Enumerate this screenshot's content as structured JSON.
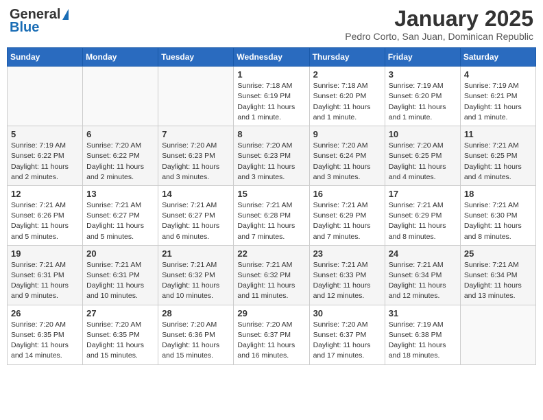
{
  "logo": {
    "general": "General",
    "blue": "Blue"
  },
  "title": "January 2025",
  "location": "Pedro Corto, San Juan, Dominican Republic",
  "days_of_week": [
    "Sunday",
    "Monday",
    "Tuesday",
    "Wednesday",
    "Thursday",
    "Friday",
    "Saturday"
  ],
  "weeks": [
    [
      {
        "day": "",
        "info": ""
      },
      {
        "day": "",
        "info": ""
      },
      {
        "day": "",
        "info": ""
      },
      {
        "day": "1",
        "info": "Sunrise: 7:18 AM\nSunset: 6:19 PM\nDaylight: 11 hours\nand 1 minute."
      },
      {
        "day": "2",
        "info": "Sunrise: 7:18 AM\nSunset: 6:20 PM\nDaylight: 11 hours\nand 1 minute."
      },
      {
        "day": "3",
        "info": "Sunrise: 7:19 AM\nSunset: 6:20 PM\nDaylight: 11 hours\nand 1 minute."
      },
      {
        "day": "4",
        "info": "Sunrise: 7:19 AM\nSunset: 6:21 PM\nDaylight: 11 hours\nand 1 minute."
      }
    ],
    [
      {
        "day": "5",
        "info": "Sunrise: 7:19 AM\nSunset: 6:22 PM\nDaylight: 11 hours\nand 2 minutes."
      },
      {
        "day": "6",
        "info": "Sunrise: 7:20 AM\nSunset: 6:22 PM\nDaylight: 11 hours\nand 2 minutes."
      },
      {
        "day": "7",
        "info": "Sunrise: 7:20 AM\nSunset: 6:23 PM\nDaylight: 11 hours\nand 3 minutes."
      },
      {
        "day": "8",
        "info": "Sunrise: 7:20 AM\nSunset: 6:23 PM\nDaylight: 11 hours\nand 3 minutes."
      },
      {
        "day": "9",
        "info": "Sunrise: 7:20 AM\nSunset: 6:24 PM\nDaylight: 11 hours\nand 3 minutes."
      },
      {
        "day": "10",
        "info": "Sunrise: 7:20 AM\nSunset: 6:25 PM\nDaylight: 11 hours\nand 4 minutes."
      },
      {
        "day": "11",
        "info": "Sunrise: 7:21 AM\nSunset: 6:25 PM\nDaylight: 11 hours\nand 4 minutes."
      }
    ],
    [
      {
        "day": "12",
        "info": "Sunrise: 7:21 AM\nSunset: 6:26 PM\nDaylight: 11 hours\nand 5 minutes."
      },
      {
        "day": "13",
        "info": "Sunrise: 7:21 AM\nSunset: 6:27 PM\nDaylight: 11 hours\nand 5 minutes."
      },
      {
        "day": "14",
        "info": "Sunrise: 7:21 AM\nSunset: 6:27 PM\nDaylight: 11 hours\nand 6 minutes."
      },
      {
        "day": "15",
        "info": "Sunrise: 7:21 AM\nSunset: 6:28 PM\nDaylight: 11 hours\nand 7 minutes."
      },
      {
        "day": "16",
        "info": "Sunrise: 7:21 AM\nSunset: 6:29 PM\nDaylight: 11 hours\nand 7 minutes."
      },
      {
        "day": "17",
        "info": "Sunrise: 7:21 AM\nSunset: 6:29 PM\nDaylight: 11 hours\nand 8 minutes."
      },
      {
        "day": "18",
        "info": "Sunrise: 7:21 AM\nSunset: 6:30 PM\nDaylight: 11 hours\nand 8 minutes."
      }
    ],
    [
      {
        "day": "19",
        "info": "Sunrise: 7:21 AM\nSunset: 6:31 PM\nDaylight: 11 hours\nand 9 minutes."
      },
      {
        "day": "20",
        "info": "Sunrise: 7:21 AM\nSunset: 6:31 PM\nDaylight: 11 hours\nand 10 minutes."
      },
      {
        "day": "21",
        "info": "Sunrise: 7:21 AM\nSunset: 6:32 PM\nDaylight: 11 hours\nand 10 minutes."
      },
      {
        "day": "22",
        "info": "Sunrise: 7:21 AM\nSunset: 6:32 PM\nDaylight: 11 hours\nand 11 minutes."
      },
      {
        "day": "23",
        "info": "Sunrise: 7:21 AM\nSunset: 6:33 PM\nDaylight: 11 hours\nand 12 minutes."
      },
      {
        "day": "24",
        "info": "Sunrise: 7:21 AM\nSunset: 6:34 PM\nDaylight: 11 hours\nand 12 minutes."
      },
      {
        "day": "25",
        "info": "Sunrise: 7:21 AM\nSunset: 6:34 PM\nDaylight: 11 hours\nand 13 minutes."
      }
    ],
    [
      {
        "day": "26",
        "info": "Sunrise: 7:20 AM\nSunset: 6:35 PM\nDaylight: 11 hours\nand 14 minutes."
      },
      {
        "day": "27",
        "info": "Sunrise: 7:20 AM\nSunset: 6:35 PM\nDaylight: 11 hours\nand 15 minutes."
      },
      {
        "day": "28",
        "info": "Sunrise: 7:20 AM\nSunset: 6:36 PM\nDaylight: 11 hours\nand 15 minutes."
      },
      {
        "day": "29",
        "info": "Sunrise: 7:20 AM\nSunset: 6:37 PM\nDaylight: 11 hours\nand 16 minutes."
      },
      {
        "day": "30",
        "info": "Sunrise: 7:20 AM\nSunset: 6:37 PM\nDaylight: 11 hours\nand 17 minutes."
      },
      {
        "day": "31",
        "info": "Sunrise: 7:19 AM\nSunset: 6:38 PM\nDaylight: 11 hours\nand 18 minutes."
      },
      {
        "day": "",
        "info": ""
      }
    ]
  ]
}
